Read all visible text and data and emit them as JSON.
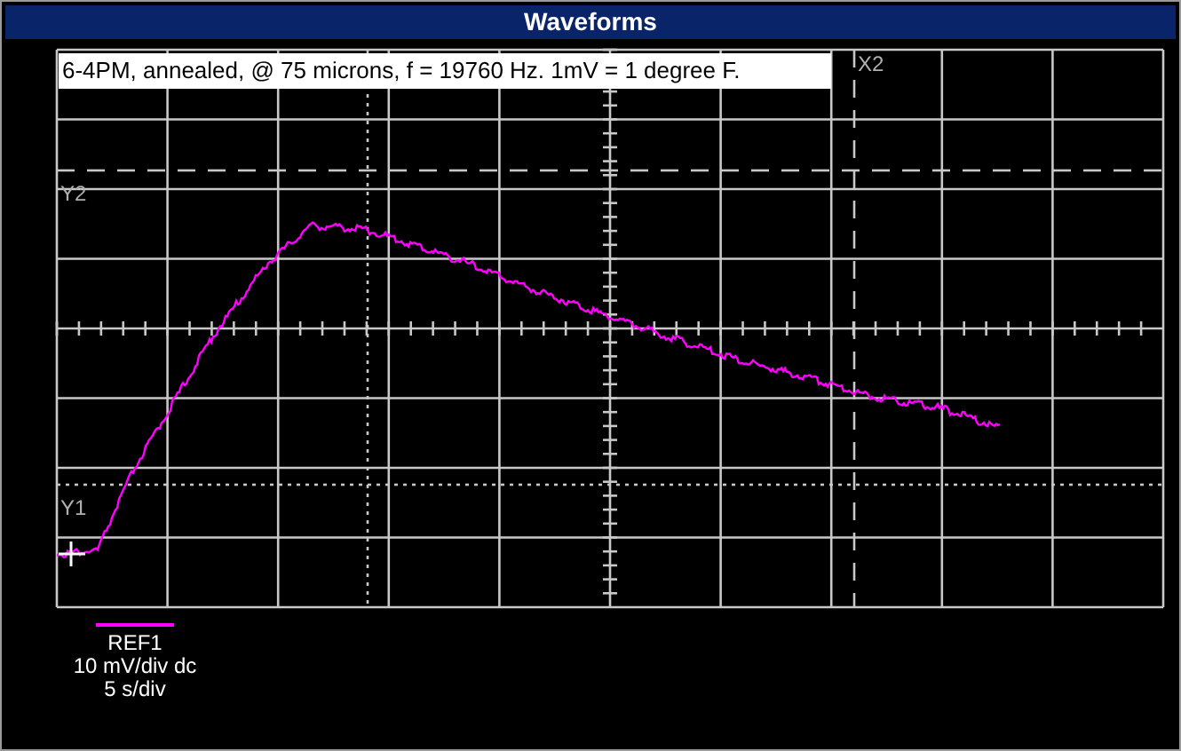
{
  "window": {
    "title": "Waveforms"
  },
  "annotation": "6-4PM, annealed, @ 75 microns, f = 19760 Hz. 1mV = 1 degree F.",
  "cursors": [
    {
      "kind": "horizontal",
      "dashed": true,
      "label": "Y2"
    },
    {
      "kind": "horizontal",
      "dashed": false,
      "label": "Y1"
    },
    {
      "kind": "vertical",
      "dashed": false
    },
    {
      "kind": "vertical",
      "dashed": true,
      "label": "X2"
    }
  ],
  "legend": {
    "trace": "REF1",
    "scale": "10 mV/div dc",
    "timebase": "5 s/div"
  }
}
